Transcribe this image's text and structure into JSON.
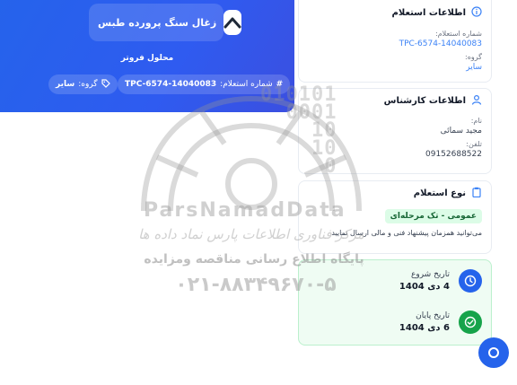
{
  "header": {
    "title": "زغال سنگ پرورده طبس",
    "subtitle": "محلول فروتر",
    "inquiry_chip": {
      "label": "شماره استعلام:",
      "value": "TPC-6574-14040083"
    },
    "group_chip": {
      "label": "گروه:",
      "value": "سایر"
    }
  },
  "inquiry_info": {
    "heading": "اطلاعات استعلام",
    "number_label": "شماره استعلام:",
    "number_value": "TPC-6574-14040083",
    "group_label": "گروه:",
    "group_value": "سایر"
  },
  "expert_info": {
    "heading": "اطلاعات کارشناس",
    "name_label": "نام:",
    "name_value": "مجید سمائی",
    "phone_label": "تلفن:",
    "phone_value": "09152688522"
  },
  "inquiry_type": {
    "heading": "نوع استعلام",
    "tag": "عمومی - تک مرحله‌ای",
    "note": "می‌توانید همزمان پیشنهاد فنی و مالی ارسال نمایید"
  },
  "dates": {
    "start_label": "تاریخ شروع",
    "start_value": "4 دی 1404",
    "end_label": "تاریخ پایان",
    "end_value": "6 دی 1404"
  },
  "watermark": {
    "digits": [
      "010101",
      "0001",
      "10",
      "10",
      "0"
    ],
    "brand": "ParsNamadData",
    "line1": "مرکز فناوری اطلاعات پارس نماد داده ها",
    "line2": "پایگاه اطلاع رسانی مناقصه ومزایده",
    "phone": "۰۲۱-۸۸۳۴۹۶۷۰-۵"
  },
  "colors": {
    "primary": "#2563eb",
    "success_bg": "#effcf3",
    "tag_bg": "#dcfce7"
  }
}
